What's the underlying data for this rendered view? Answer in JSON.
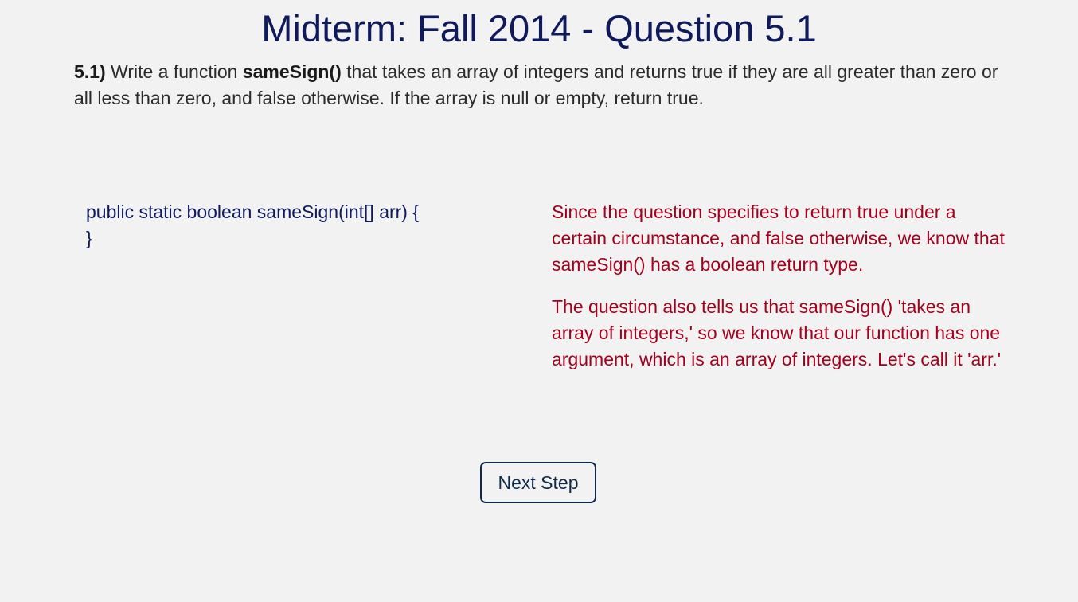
{
  "page": {
    "title": "Midterm: Fall 2014 - Question 5.1"
  },
  "question": {
    "number": "5.1)",
    "text_before": " Write a function ",
    "function_name": "sameSign()",
    "text_after": " that takes an array of integers and returns true if they are all greater than zero or all less than zero, and false otherwise. If the array is null or empty, return true."
  },
  "code": {
    "line1": "public static boolean sameSign(int[] arr) {",
    "line2": "}"
  },
  "explanation": {
    "paragraph1": "Since the question specifies to return true under a certain circumstance, and false otherwise, we know that sameSign() has a boolean return type.",
    "paragraph2": "The question also tells us that sameSign() 'takes an array of integers,' so we know that our function has one argument, which is an array of integers. Let's call it 'arr.'"
  },
  "controls": {
    "next_label": "Next Step"
  },
  "colors": {
    "background": "#f2f2f2",
    "title": "#0f1a5c",
    "explanation": "#a3001e",
    "button_border": "#0f2a4a"
  }
}
